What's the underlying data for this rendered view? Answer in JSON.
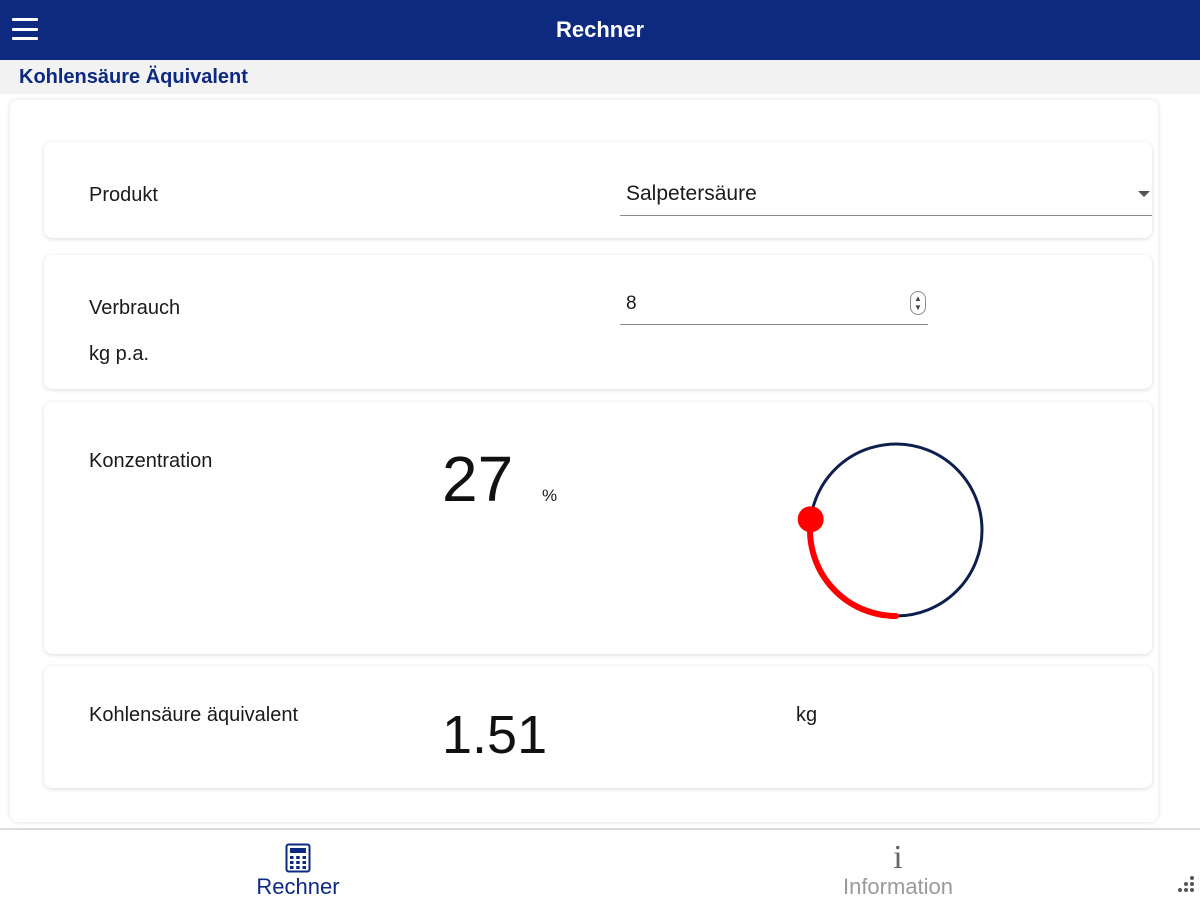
{
  "header": {
    "title": "Rechner",
    "menu_icon": "hamburger-menu-icon"
  },
  "subheader": {
    "title": "Kohlensäure Äquivalent"
  },
  "produkt": {
    "label": "Produkt",
    "selected": "Salpetersäure"
  },
  "verbrauch": {
    "label": "Verbrauch",
    "unit": "kg p.a.",
    "value": "8"
  },
  "konzentration": {
    "label": "Konzentration",
    "value": "27",
    "unit": "%",
    "percent": 27
  },
  "kohlensaeure": {
    "label": "Kohlensäure äquivalent",
    "value": "1.51",
    "unit": "kg"
  },
  "tabs": [
    {
      "label": "Rechner",
      "icon": "calculator-icon",
      "active": true
    },
    {
      "label": "Information",
      "icon": "info-icon",
      "active": false
    }
  ],
  "colors": {
    "primary": "#0d2a80",
    "knob_track": "#0f1f4d",
    "knob_progress": "#ff0000",
    "tab_inactive": "#9a9a9a"
  }
}
